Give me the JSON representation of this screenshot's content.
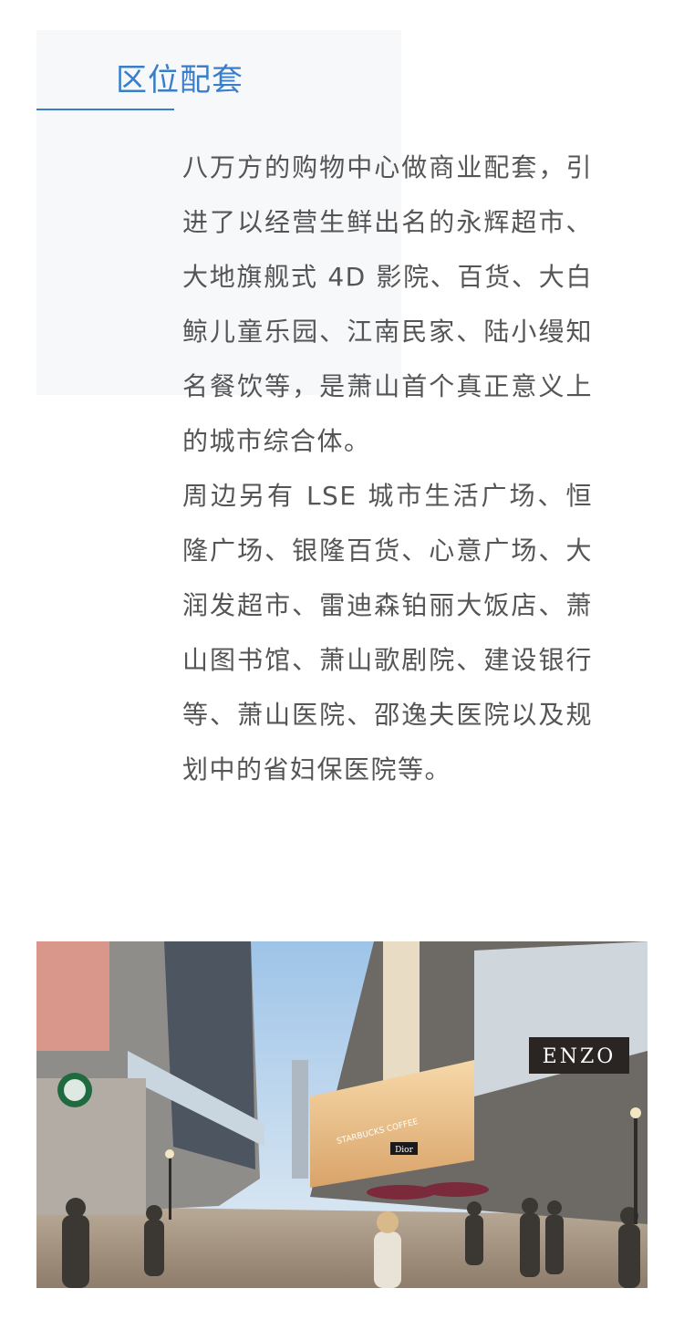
{
  "section": {
    "title": "区位配套"
  },
  "paragraphs": [
    "八万方的购物中心做商业配套，引进了以经营生鲜出名的永辉超市、大地旗舰式 4D 影院、百货、大白鲸儿童乐园、江南民家、陆小缦知名餐饮等，是萧山首个真正意义上的城市综合体。",
    "周边另有 LSE 城市生活广场、恒隆广场、银隆百货、心意广场、大润发超市、雷迪森铂丽大饭店、萧山图书馆、萧山歌剧院、建设银行等、萧山医院、邵逸夫医院以及规划中的省妇保医院等。"
  ],
  "photo": {
    "signs": {
      "enzo": "ENZO",
      "starbucks": "STARBUCKS COFFEE",
      "dior": "Dior"
    }
  },
  "colors": {
    "accent": "#3a7ec9",
    "body_text": "#555555",
    "panel": "#f7f8fa"
  }
}
